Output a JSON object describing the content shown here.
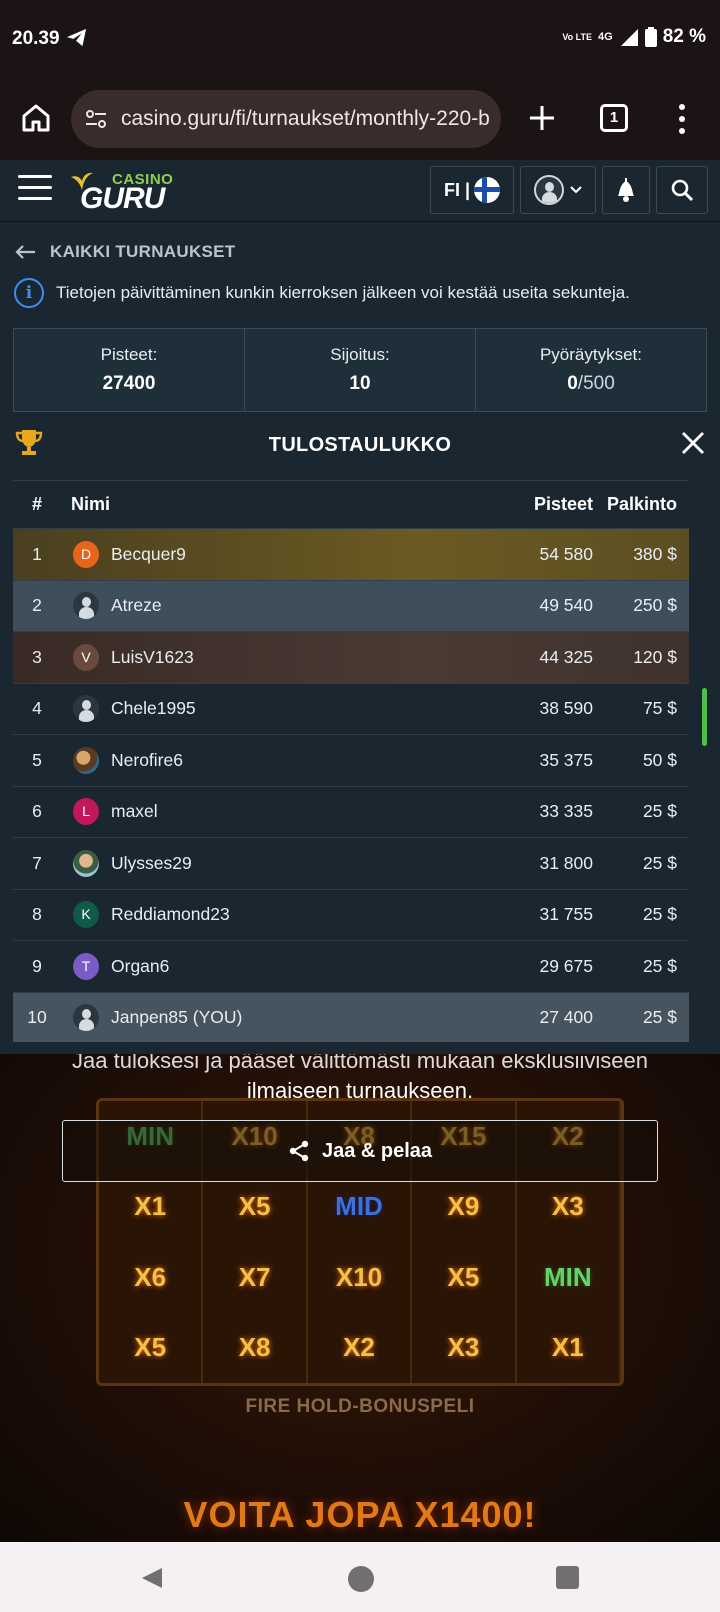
{
  "statusbar": {
    "time": "20.39",
    "network": "4G",
    "lte": "Vo LTE",
    "battery": "82 %"
  },
  "browser": {
    "url": "casino.guru/fi/turnaukset/monthly-220-b",
    "tab_count": "1"
  },
  "header": {
    "logo_casino": "CASINO",
    "logo_guru": "GURU",
    "lang": "FI |"
  },
  "page": {
    "back_label": "KAIKKI TURNAUKSET",
    "info_text": "Tietojen päivittäminen kunkin kierroksen jälkeen voi kestää useita sekunteja.",
    "stats": {
      "points_label": "Pisteet:",
      "points_value": "27400",
      "rank_label": "Sijoitus:",
      "rank_value": "10",
      "spins_label": "Pyöräytykset:",
      "spins_done": "0",
      "spins_total": "/500"
    },
    "leaderboard_title": "TULOSTAULUKKO"
  },
  "table": {
    "headers": {
      "rank": "#",
      "name": "Nimi",
      "points": "Pisteet",
      "prize": "Palkinto"
    },
    "rows": [
      {
        "rank": "1",
        "initial": "D",
        "name": "Becquer9",
        "points": "54 580",
        "prize": "380 $"
      },
      {
        "rank": "2",
        "initial": "",
        "name": "Atreze",
        "points": "49 540",
        "prize": "250 $"
      },
      {
        "rank": "3",
        "initial": "V",
        "name": "LuisV1623",
        "points": "44 325",
        "prize": "120 $"
      },
      {
        "rank": "4",
        "initial": "",
        "name": "Chele1995",
        "points": "38 590",
        "prize": "75 $"
      },
      {
        "rank": "5",
        "initial": "",
        "name": "Nerofire6",
        "points": "35 375",
        "prize": "50 $"
      },
      {
        "rank": "6",
        "initial": "L",
        "name": "maxel",
        "points": "33 335",
        "prize": "25 $"
      },
      {
        "rank": "7",
        "initial": "",
        "name": "Ulysses29",
        "points": "31 800",
        "prize": "25 $"
      },
      {
        "rank": "8",
        "initial": "K",
        "name": "Reddiamond23",
        "points": "31 755",
        "prize": "25 $"
      },
      {
        "rank": "9",
        "initial": "T",
        "name": "Organ6",
        "points": "29 675",
        "prize": "25 $"
      },
      {
        "rank": "10",
        "initial": "",
        "name": "Janpen85 (YOU)",
        "points": "27 400",
        "prize": "25 $"
      }
    ]
  },
  "promo": {
    "text_line1": "Jaa tuloksesi ja pääset välittömästi mukaan eksklusiiviseen",
    "text_line2": "ilmaiseen turnaukseen.",
    "share_label": "Jaa & pelaa",
    "reels": [
      [
        "MIN",
        "X10",
        "X8",
        "X15",
        "X2"
      ],
      [
        "X1",
        "X5",
        "MID",
        "X9",
        "X3"
      ],
      [
        "X6",
        "X7",
        "X10",
        "X5",
        "MIN"
      ],
      [
        "X5",
        "X8",
        "X2",
        "X3",
        "X1"
      ]
    ],
    "feature_label": "FIRE HOLD-BONUSPELI",
    "win_label": "VOITA JOPA X1400!"
  },
  "colors": {
    "accent_blue": "#3c8ff0",
    "av_orange": "#e8641a",
    "av_brown": "#6a4a3e",
    "av_pink": "#c2185b",
    "av_green": "#0f5a48",
    "av_purple": "#7c5ac8"
  }
}
